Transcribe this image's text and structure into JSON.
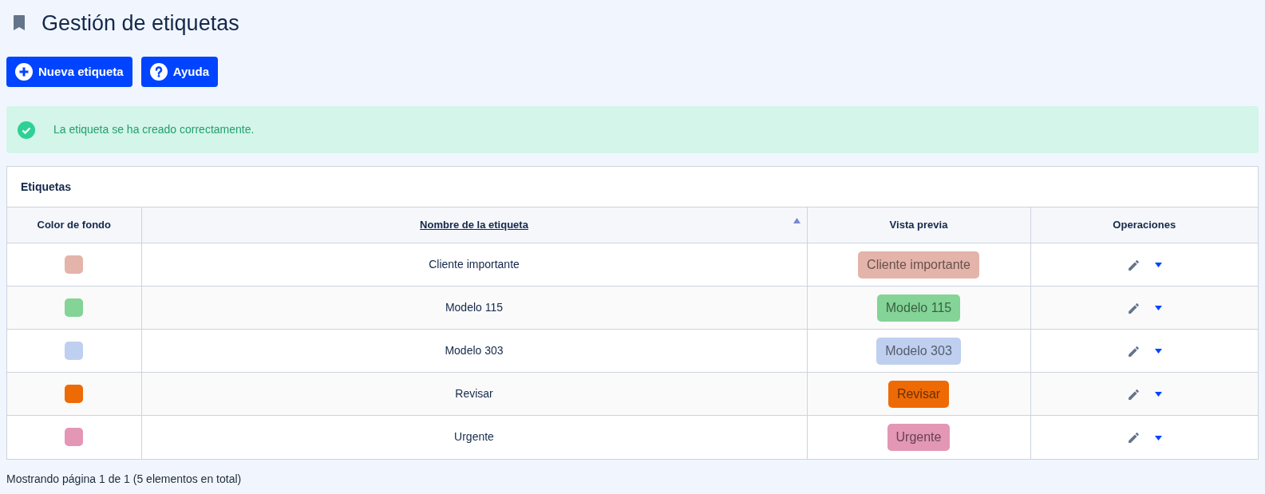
{
  "page": {
    "title": "Gestión de etiquetas"
  },
  "toolbar": [
    {
      "kind": "add",
      "label": "Nueva etiqueta"
    },
    {
      "kind": "help",
      "label": "Ayuda"
    }
  ],
  "alert": {
    "kind": "success",
    "message": "La etiqueta se ha creado correctamente."
  },
  "table": {
    "title": "Etiquetas",
    "columns": [
      {
        "label": "Color de fondo",
        "sorted": false
      },
      {
        "label": "Nombre de la etiqueta",
        "sorted": true
      },
      {
        "label": "Vista previa",
        "sorted": false
      },
      {
        "label": "Operaciones",
        "sorted": false
      }
    ],
    "rows": [
      {
        "name": "Cliente importante",
        "preview": "Cliente importante",
        "color": "#e4b4aa"
      },
      {
        "name": "Modelo 115",
        "preview": "Modelo 115",
        "color": "#83d496"
      },
      {
        "name": "Modelo 303",
        "preview": "Modelo 303",
        "color": "#bfcff0"
      },
      {
        "name": "Revisar",
        "preview": "Revisar",
        "color": "#ee6a05"
      },
      {
        "name": "Urgente",
        "preview": "Urgente",
        "color": "#e397b4"
      }
    ]
  },
  "footer": {
    "text": "Mostrando página 1 de 1 (5 elementos en total)"
  }
}
